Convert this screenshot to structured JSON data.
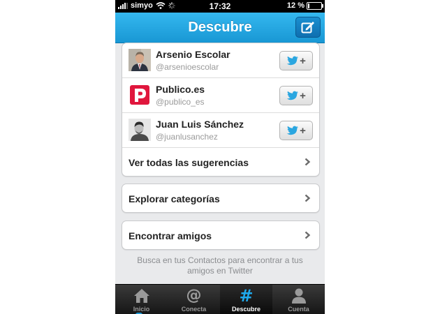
{
  "status_bar": {
    "carrier": "simyo",
    "time": "17:32",
    "battery_percent": "12 %",
    "battery_level": 0.12
  },
  "nav": {
    "title": "Descubre",
    "compose_icon": "compose-icon"
  },
  "suggestions": [
    {
      "name": "Arsenio Escolar",
      "handle": "@arsenioescolar",
      "avatar": "portrait-man-suit"
    },
    {
      "name": "Publico.es",
      "handle": "@publico_es",
      "avatar": "publico-logo"
    },
    {
      "name": "Juan Luis Sánchez",
      "handle": "@juanlusanchez",
      "avatar": "portrait-man-bw"
    }
  ],
  "suggestions_all_label": "Ver todas las sugerencias",
  "links": {
    "explore": "Explorar categorías",
    "find_friends": "Encontrar amigos"
  },
  "hint": "Busca en tus Contactos para encontrar a tus amigos en Twitter",
  "tabs": [
    {
      "label": "Inicio",
      "icon": "home-icon"
    },
    {
      "label": "Conecta",
      "icon": "at-icon"
    },
    {
      "label": "Descubre",
      "icon": "hash-icon",
      "active": true
    },
    {
      "label": "Cuenta",
      "icon": "person-icon"
    }
  ],
  "colors": {
    "nav_blue": "#1ea3e3",
    "active_tab": "#1fa9ec",
    "twitter_bird": "#2aa6e0"
  }
}
